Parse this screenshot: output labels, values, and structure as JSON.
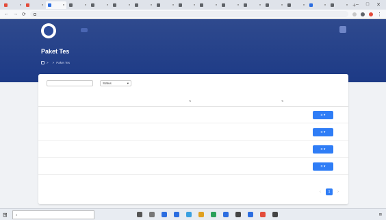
{
  "browser": {
    "tabs": [
      {
        "label": "",
        "active": false,
        "color": "#e34b3a"
      },
      {
        "label": "",
        "active": false,
        "color": "#e34b3a"
      },
      {
        "label": "",
        "active": true,
        "color": "#2b6de0"
      },
      {
        "label": "",
        "active": false,
        "color": "#5f6368"
      },
      {
        "label": "",
        "active": false,
        "color": "#5f6368"
      },
      {
        "label": "",
        "active": false,
        "color": "#5f6368"
      },
      {
        "label": "",
        "active": false,
        "color": "#5f6368"
      },
      {
        "label": "",
        "active": false,
        "color": "#5f6368"
      },
      {
        "label": "",
        "active": false,
        "color": "#5f6368"
      },
      {
        "label": "",
        "active": false,
        "color": "#5f6368"
      },
      {
        "label": "",
        "active": false,
        "color": "#5f6368"
      },
      {
        "label": "",
        "active": false,
        "color": "#5f6368"
      },
      {
        "label": "",
        "active": false,
        "color": "#5f6368"
      },
      {
        "label": "",
        "active": false,
        "color": "#5f6368"
      },
      {
        "label": "",
        "active": false,
        "color": "#2b6de0"
      },
      {
        "label": "",
        "active": false,
        "color": "#5f6368"
      }
    ],
    "new_tab": "+",
    "win_min": "–",
    "win_max": "□",
    "win_close": "✕",
    "back": "←",
    "forward": "→",
    "reload": "⟳",
    "url": ""
  },
  "header": {
    "menu": [
      {
        "label": "",
        "active": false
      },
      {
        "label": "",
        "active": true
      },
      {
        "label": "",
        "active": false
      },
      {
        "label": "",
        "active": false
      },
      {
        "label": "",
        "active": false
      }
    ],
    "user_name": "",
    "avatar_initial": ""
  },
  "page": {
    "title": "Paket Tes",
    "breadcrumb": [
      "",
      "Paket Tes"
    ],
    "breadcrumb_sep": ">"
  },
  "filter": {
    "label": "",
    "search_placeholder": "",
    "select_value": "Status",
    "select_caret": "▾",
    "per_page": ""
  },
  "table": {
    "columns": [
      "",
      "",
      ""
    ],
    "sort_mark": "⇅",
    "rows": [
      {
        "name": "",
        "status": ""
      },
      {
        "name": "",
        "status": ""
      },
      {
        "name": "",
        "status": ""
      },
      {
        "name": "",
        "status": ""
      }
    ],
    "action_label": "≡ ▾"
  },
  "footer": {
    "info": "",
    "pages": [
      "‹",
      "1",
      "›"
    ]
  },
  "taskbar": {
    "start": "⊞",
    "search_placeholder": "",
    "app_colors": [
      "#555",
      "#777",
      "#2b6de0",
      "#2b6de0",
      "#3aa0e0",
      "#e0a020",
      "#2aa05a",
      "#2b6de0",
      "#444",
      "#2b6de0",
      "#e34b3a",
      "#444"
    ],
    "tray_text": "",
    "time": "",
    "date": ""
  },
  "colors": {
    "header": "#1d3a86",
    "accent": "#2f7df6"
  }
}
